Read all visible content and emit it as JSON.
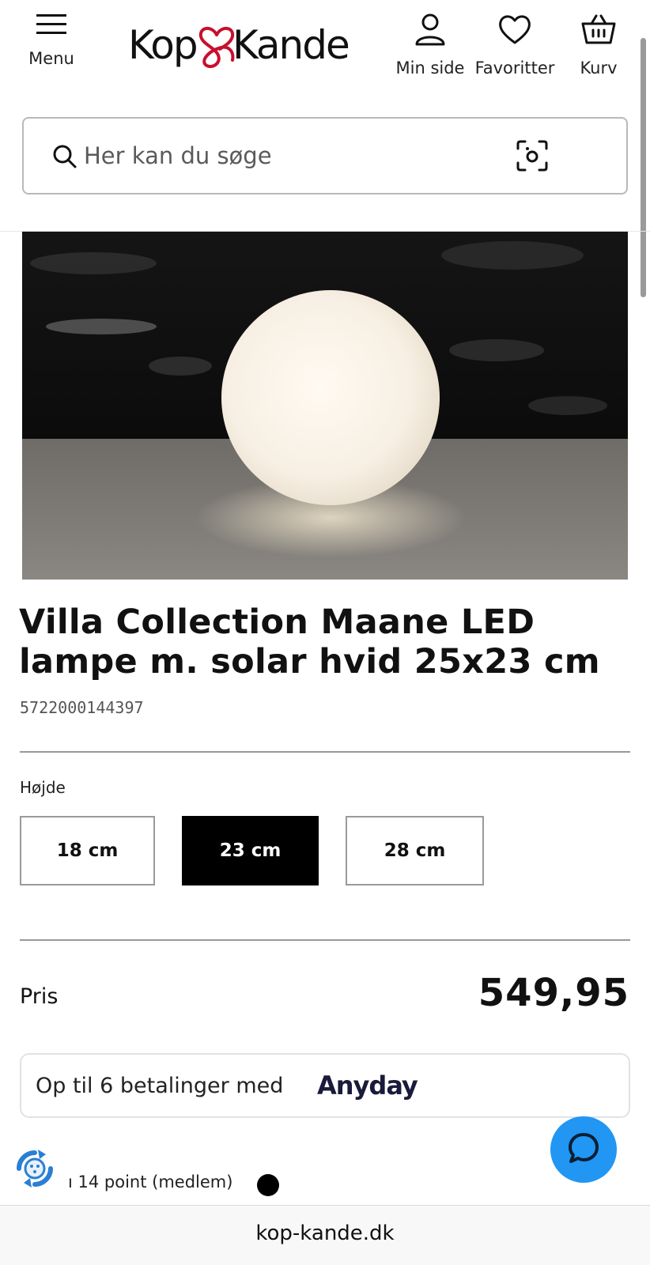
{
  "header": {
    "menu_label": "Menu",
    "logo_left": "Kop",
    "logo_right": "Kande",
    "logo_ampersand": "&",
    "account_label": "Min side",
    "favorites_label": "Favoritter",
    "cart_label": "Kurv"
  },
  "search": {
    "placeholder": "Her kan du søge"
  },
  "product": {
    "image_alt": "Villa Collection Maane LED lampe",
    "title": "Villa Collection Maane LED lampe m. solar hvid 25x23 cm",
    "sku": "5722000144397"
  },
  "options": {
    "label": "Højde",
    "values": [
      "18 cm",
      "23 cm",
      "28 cm"
    ],
    "selected": "23 cm"
  },
  "price": {
    "label": "Pris",
    "value": "549,95"
  },
  "payment": {
    "text": "Op til 6 betalinger med",
    "brand": "Anyday"
  },
  "points": {
    "text": "ı 14 point (medlem)"
  },
  "browser": {
    "url": "kop-kande.dk"
  },
  "colors": {
    "accent_red": "#c8102e",
    "chat_blue": "#2196f3",
    "selected_bg": "#000000"
  }
}
